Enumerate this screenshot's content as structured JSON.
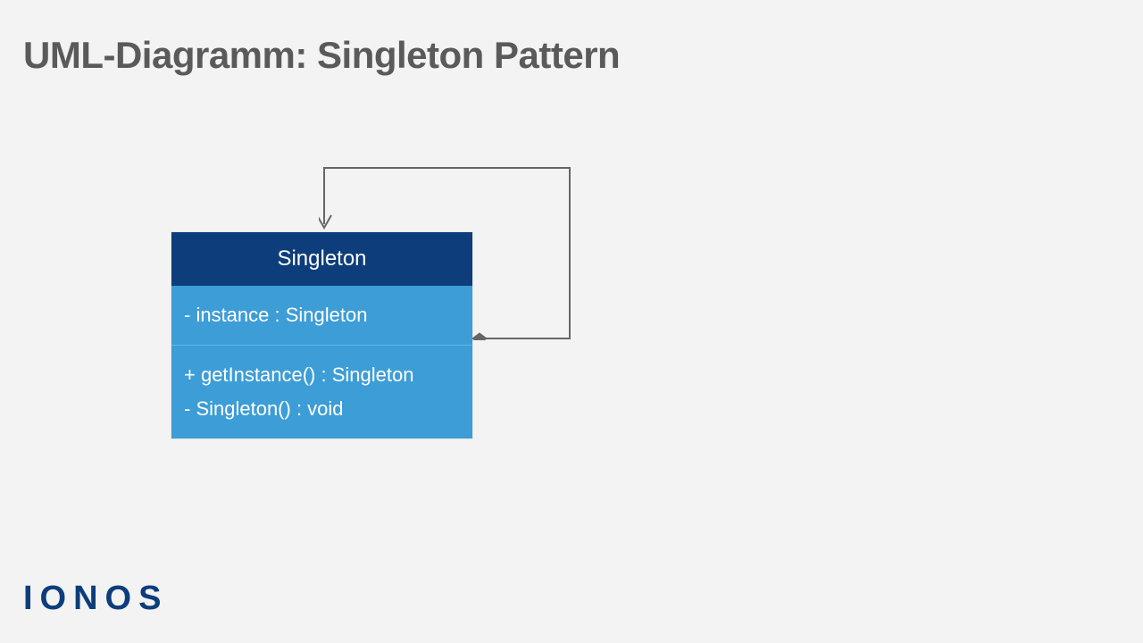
{
  "title": "UML-Diagramm: Singleton Pattern",
  "class": {
    "name": "Singleton",
    "attributes": [
      "-  instance : Singleton"
    ],
    "operations": [
      "+ getInstance() : Singleton",
      "-  Singleton() : void"
    ]
  },
  "logo": "IONOS",
  "colors": {
    "header_bg": "#0d3d7a",
    "body_bg": "#3d9dd6",
    "page_bg": "#f3f3f3",
    "title_color": "#5a5a5a",
    "connector": "#666666"
  }
}
